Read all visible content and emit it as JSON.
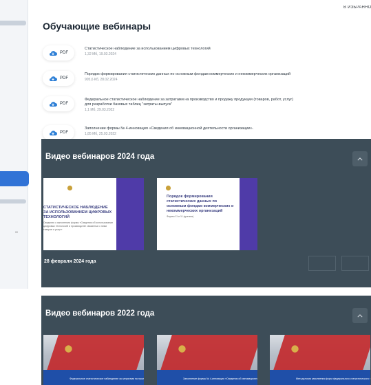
{
  "header": {
    "favorites_label": "В ИЗБРАННОЕ"
  },
  "page_title": "Обучающие вебинары",
  "files": [
    {
      "type": "PDF",
      "title": "Статистическое наблюдение за использованием цифровых технологий",
      "meta": "1,32 Mб, 19.03.2024"
    },
    {
      "type": "PDF",
      "title": "Порядок формирования статистических данных по основным фондам коммерческих и некоммерческих организаций",
      "meta": "905,6 Кб, 28.02.2024"
    },
    {
      "type": "PDF",
      "title": "Федеральное статистическое наблюдение за затратами на производство и продажу продукции (товаров, работ, услуг)",
      "title2": "для разработки базовых таблиц \"затраты-выпуск\"",
      "meta": "1,1 Mб, 29.03.2022"
    },
    {
      "type": "PDF",
      "title": "Заполнение формы № 4-инновация «Сведения об инновационной деятельности организации».",
      "meta": "1,85 Mб, 25.03.2022"
    }
  ],
  "sections": [
    {
      "title": "Видео вебинаров 2024 года",
      "date": "28 февраля 2024 года",
      "thumbs": [
        {
          "lines": [
            "СТАТИСТИЧЕСКОЕ НАБЛЮДЕНИЕ",
            "ЗА ИСПОЛЬЗОВАНИЕМ ЦИФРОВЫХ",
            "ТЕХНОЛОГИЙ"
          ],
          "sub": [
            "Сведения о заполнении формы «Сведения об использовании",
            "цифровых технологий и производстве связанных с ними",
            "товаров и услуг»"
          ]
        },
        {
          "lines": [
            "Порядок формирования",
            "статистических данных по",
            "основным фондам коммерческих и",
            "некоммерческих организаций"
          ],
          "sub": [
            "Формы 11 и 11 (краткая)"
          ]
        }
      ]
    },
    {
      "title": "Видео вебинаров 2022 года",
      "thumbs": [
        {
          "caption": "Федеральное статистическое наблюдение за затратами на производство и продажу продукции"
        },
        {
          "caption": "Заполнение формы № 4-инновация «Сведения об инновационной деятельности»"
        },
        {
          "caption": "Методология заполнения форм федерального статистического наблюдения"
        }
      ]
    }
  ],
  "colors": {
    "accent": "#3173d6",
    "panel": "#3d4d58",
    "thumb_purple": "#4f3ba8",
    "thumb_red": "#c22a2e"
  }
}
